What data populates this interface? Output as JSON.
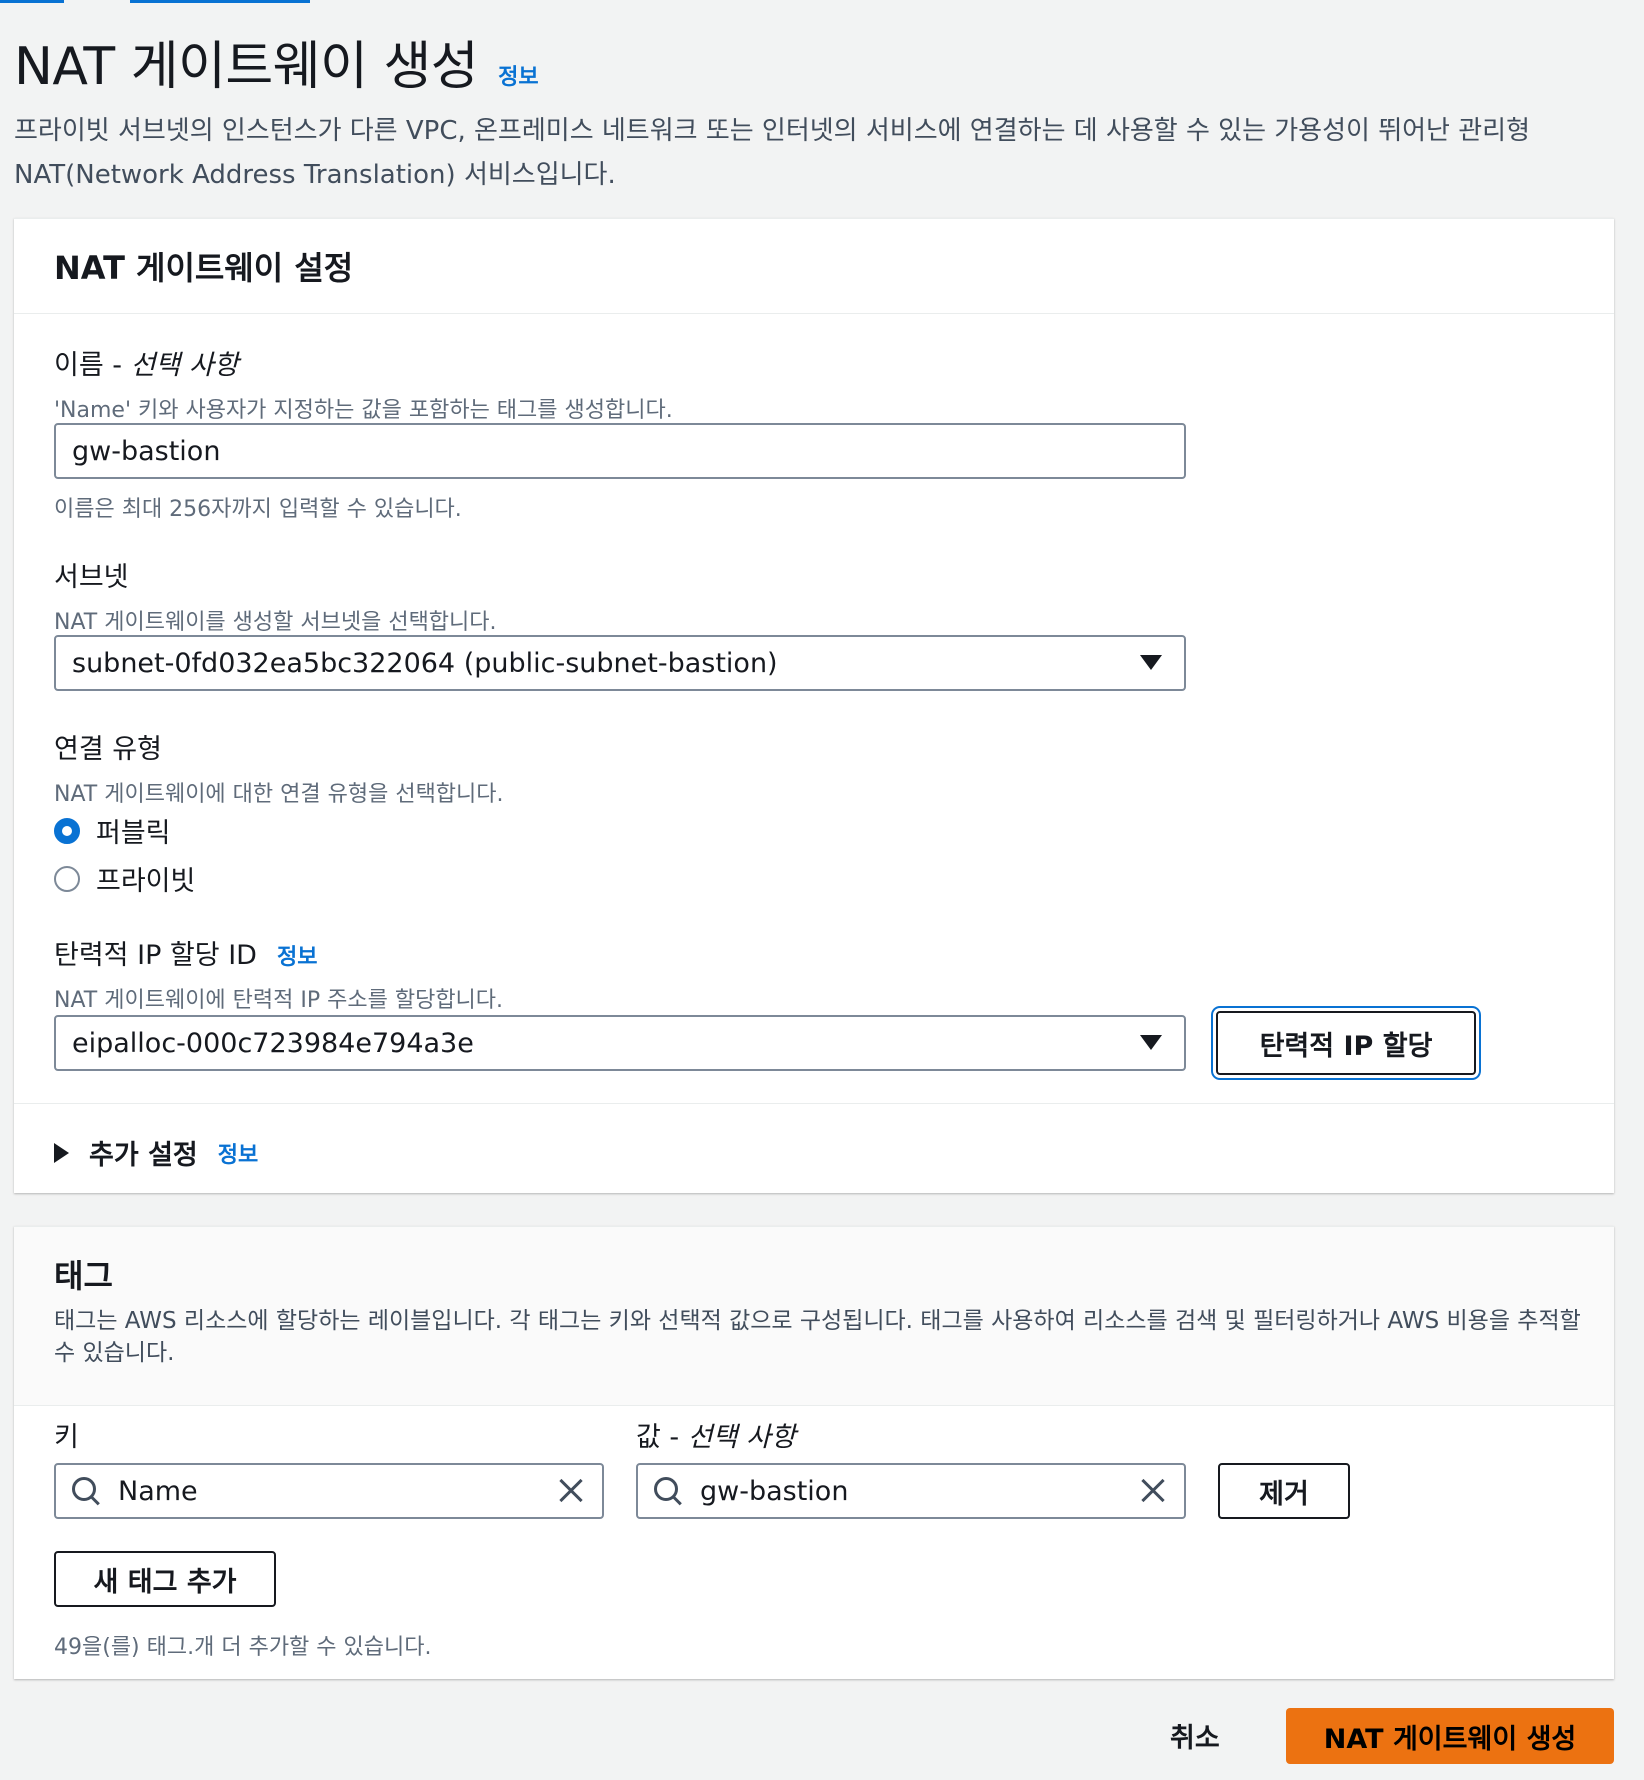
{
  "header": {
    "title": "NAT 게이트웨이 생성",
    "info": "정보",
    "description": "프라이빗 서브넷의 인스턴스가 다른 VPC, 온프레미스 네트워크 또는 인터넷의 서비스에 연결하는 데 사용할 수 있는 가용성이 뛰어난 관리형 NAT(Network Address Translation) 서비스입니다."
  },
  "settings": {
    "title": "NAT 게이트웨이 설정",
    "name": {
      "label": "이름 - ",
      "label_optional": "선택 사항",
      "description": "'Name' 키와 사용자가 지정하는 값을 포함하는 태그를 생성합니다.",
      "value": "gw-bastion",
      "constraint": "이름은 최대 256자까지 입력할 수 있습니다."
    },
    "subnet": {
      "label": "서브넷",
      "description": "NAT 게이트웨이를 생성할 서브넷을 선택합니다.",
      "value": "subnet-0fd032ea5bc322064 (public-subnet-bastion)"
    },
    "connectivity": {
      "label": "연결 유형",
      "description": "NAT 게이트웨이에 대한 연결 유형을 선택합니다.",
      "options": [
        "퍼블릭",
        "프라이빗"
      ],
      "selected": "퍼블릭"
    },
    "eip": {
      "label": "탄력적 IP 할당 ID",
      "info": "정보",
      "description": "NAT 게이트웨이에 탄력적 IP 주소를 할당합니다.",
      "value": "eipalloc-000c723984e794a3e",
      "allocate_button": "탄력적 IP 할당"
    },
    "additional": {
      "label": "추가 설정",
      "info": "정보"
    }
  },
  "tags": {
    "title": "태그",
    "description": "태그는 AWS 리소스에 할당하는 레이블입니다. 각 태그는 키와 선택적 값으로 구성됩니다. 태그를 사용하여 리소스를 검색 및 필터링하거나 AWS 비용을 추적할 수 있습니다.",
    "key_label": "키",
    "value_label": "값 - ",
    "value_label_optional": "선택 사항",
    "key_value": "Name",
    "value_value": "gw-bastion",
    "remove_button": "제거",
    "add_button": "새 태그 추가",
    "remaining": "49을(를) 태그.개 더 추가할 수 있습니다."
  },
  "footer": {
    "cancel": "취소",
    "create": "NAT 게이트웨이 생성"
  },
  "colors": {
    "accent": "#0972d3",
    "primary_button": "#ec7211",
    "background": "#f2f3f3"
  }
}
